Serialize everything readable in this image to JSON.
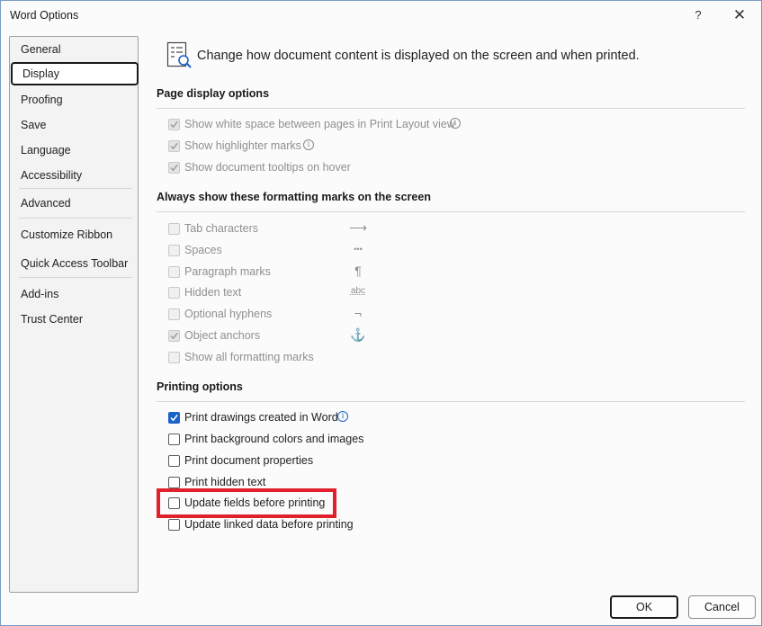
{
  "window": {
    "title": "Word Options",
    "help_label": "?",
    "close_label": "✕"
  },
  "sidebar": {
    "items": [
      {
        "label": "General"
      },
      {
        "label": "Display"
      },
      {
        "label": "Proofing"
      },
      {
        "label": "Save"
      },
      {
        "label": "Language"
      },
      {
        "label": "Accessibility"
      },
      {
        "label": "Advanced"
      },
      {
        "label": "Customize Ribbon"
      },
      {
        "label": "Quick Access Toolbar"
      },
      {
        "label": "Add-ins"
      },
      {
        "label": "Trust Center"
      }
    ],
    "selected": "Display"
  },
  "header": {
    "text": "Change how document content is displayed on the screen and when printed.",
    "icon": "display-options-icon"
  },
  "sections": {
    "page_display": {
      "title": "Page display options",
      "options": [
        {
          "label": "Show white space between pages in Print Layout view",
          "checked": true,
          "disabled": true,
          "info": true
        },
        {
          "label": "Show highlighter marks",
          "checked": true,
          "disabled": true,
          "info": true
        },
        {
          "label": "Show document tooltips on hover",
          "checked": true,
          "disabled": true
        }
      ]
    },
    "formatting_marks": {
      "title": "Always show these formatting marks on the screen",
      "options": [
        {
          "label": "Tab characters",
          "checked": false,
          "disabled": true,
          "mark": "⟶"
        },
        {
          "label": "Spaces",
          "checked": false,
          "disabled": true,
          "mark": "•••"
        },
        {
          "label": "Paragraph marks",
          "checked": false,
          "disabled": true,
          "mark": "¶"
        },
        {
          "label": "Hidden text",
          "checked": false,
          "disabled": true,
          "mark": "abc"
        },
        {
          "label": "Optional hyphens",
          "checked": false,
          "disabled": true,
          "mark": "¬"
        },
        {
          "label": "Object anchors",
          "checked": true,
          "disabled": true,
          "mark": "⚓"
        },
        {
          "label": "Show all formatting marks",
          "checked": false,
          "disabled": true
        }
      ]
    },
    "printing": {
      "title": "Printing options",
      "options": [
        {
          "label": "Print drawings created in Word",
          "checked": true,
          "disabled": false,
          "info": true
        },
        {
          "label": "Print background colors and images",
          "checked": false,
          "disabled": false
        },
        {
          "label": "Print document properties",
          "checked": false,
          "disabled": false
        },
        {
          "label": "Print hidden text",
          "checked": false,
          "disabled": false
        },
        {
          "label": "Update fields before printing",
          "checked": false,
          "disabled": false,
          "highlighted": true
        },
        {
          "label": "Update linked data before printing",
          "checked": false,
          "disabled": false
        }
      ]
    }
  },
  "buttons": {
    "ok": "OK",
    "cancel": "Cancel"
  },
  "colors": {
    "accent": "#1a62c9",
    "highlight_border": "#e0202a"
  }
}
